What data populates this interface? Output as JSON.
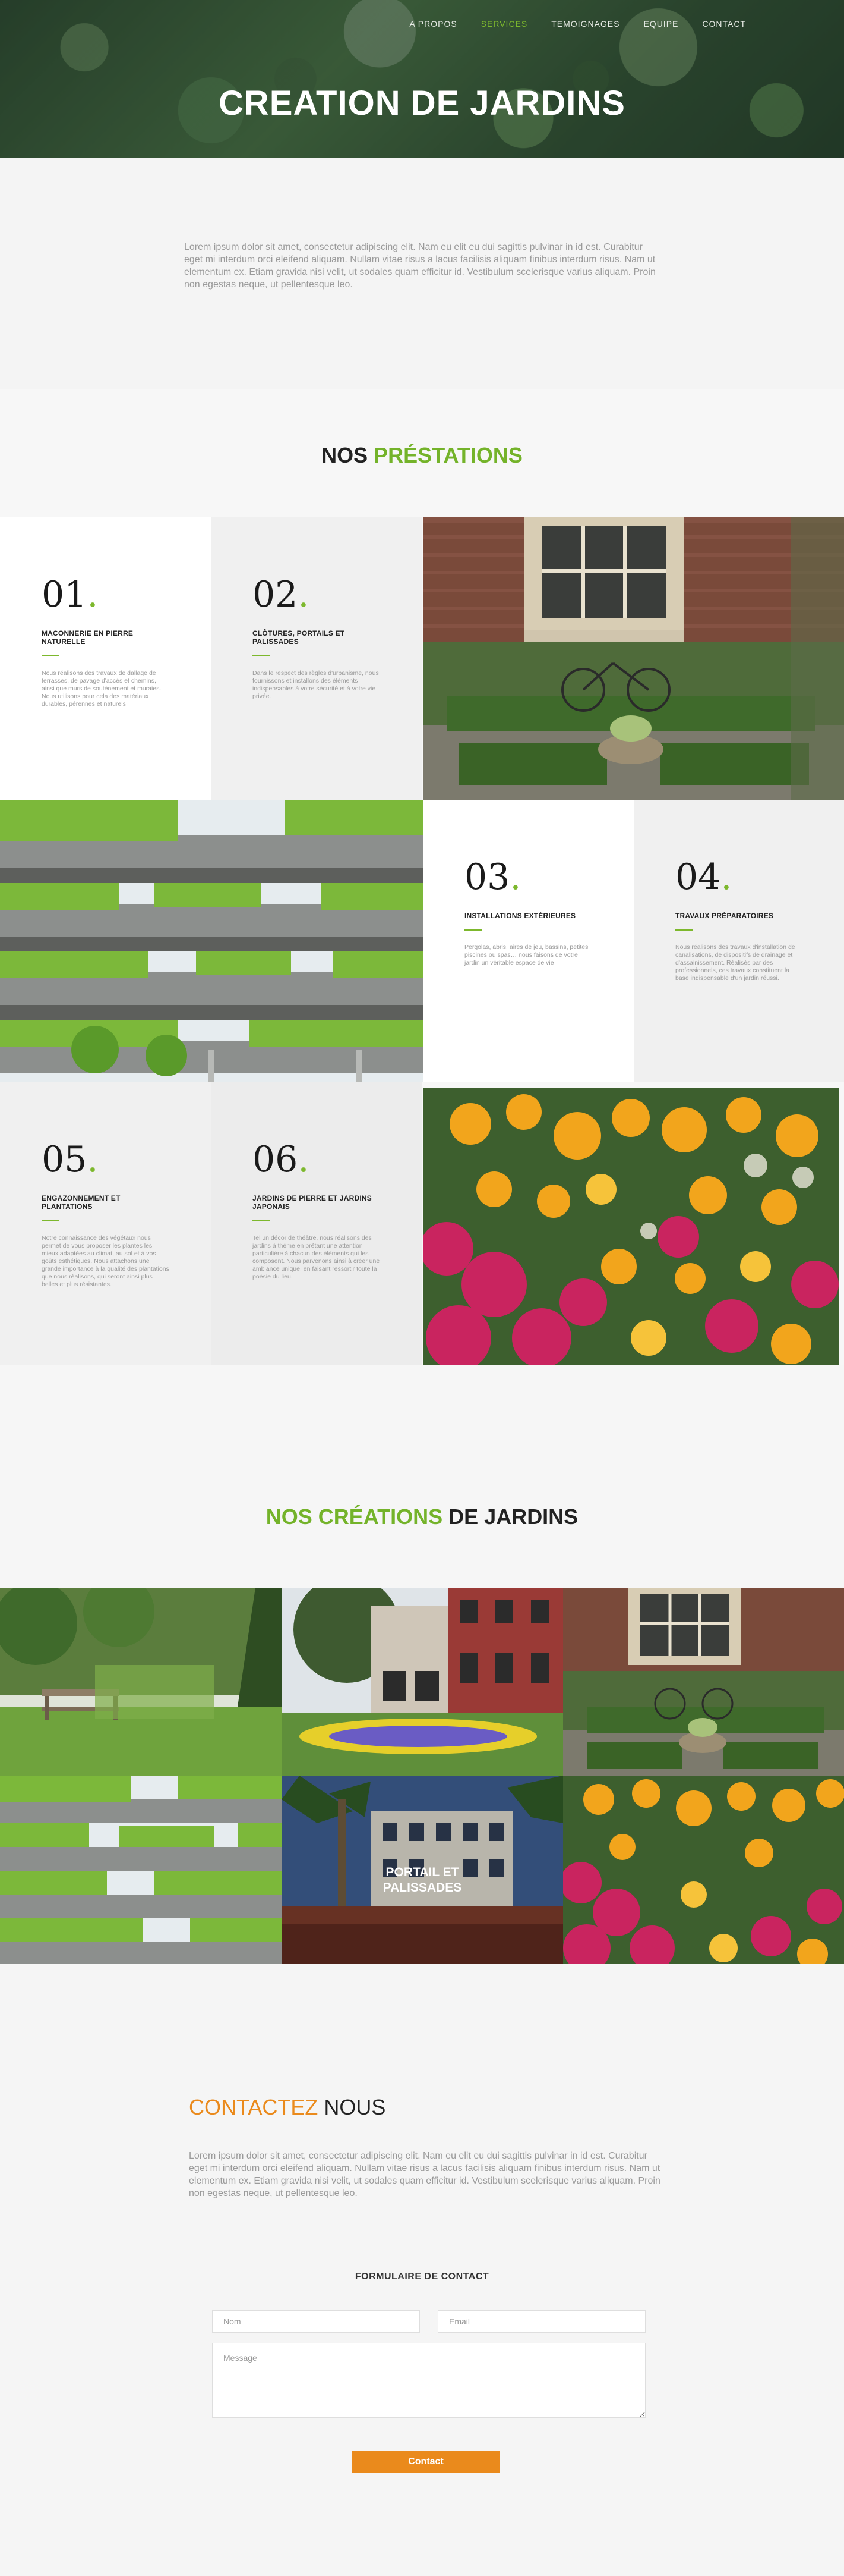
{
  "nav": {
    "items": [
      {
        "label": "A PROPOS"
      },
      {
        "label": "SERVICES"
      },
      {
        "label": "TEMOIGNAGES"
      },
      {
        "label": "EQUIPE"
      },
      {
        "label": "CONTACT"
      }
    ]
  },
  "hero": {
    "title": "CREATION DE JARDINS"
  },
  "intro": {
    "text": "Lorem ipsum dolor sit amet, consectetur adipiscing elit. Nam eu elit eu dui sagittis pulvinar in id est. Curabitur eget mi interdum orci eleifend aliquam. Nullam vitae risus a lacus facilisis aliquam finibus interdum risus. Nam ut elementum ex. Etiam gravida nisi velit, ut sodales quam efficitur id. Vestibulum scelerisque varius aliquam. Proin non egestas neque, ut pellentesque leo."
  },
  "services": {
    "title_a": "NOS ",
    "title_b": "PRÉSTATIONS",
    "items": [
      {
        "num": "01",
        "dot": ".",
        "title": "MACONNERIE EN PIERRE NATURELLE",
        "text": "Nous réalisons des travaux de dallage de terrasses, de pavage d'accès et chemins, ainsi que murs de soutènement et muraies. Nous utilisons pour cela des matériaux durables, pérennes et naturels"
      },
      {
        "num": "02",
        "dot": ".",
        "title": "CLÔTURES, PORTAILS ET PALISSADES",
        "text": "Dans le respect des règles d'urbanisme, nous fournissons et installons des éléments indispensables à votre sécurité et à votre vie privée."
      },
      {
        "num": "03",
        "dot": ".",
        "title": "INSTALLATIONS EXTÉRIEURES",
        "text": "Pergolas, abris, aires de jeu, bassins, petites piscines ou spas… nous faisons de votre jardin un véritable espace de vie"
      },
      {
        "num": "04",
        "dot": ".",
        "title": "TRAVAUX PRÉPARATOIRES",
        "text": "Nous réalisons des travaux d'installation de canalisations, de dispositifs de drainage et d'assainissement. Réalisés par des professionnels, ces travaux constituent la base indispensable d'un jardin réussi."
      },
      {
        "num": "05",
        "dot": ".",
        "title": "ENGAZONNEMENT ET PLANTATIONS",
        "text": "Notre connaissance des végétaux nous permet de vous proposer les plantes les mieux adaptées au climat, au sol et à vos goûts esthétiques. Nous attachons une grande importance à la qualité des plantations que nous réalisons, qui seront ainsi plus belles et plus résistantes."
      },
      {
        "num": "06",
        "dot": ".",
        "title": "JARDINS DE PIERRE ET JARDINS JAPONAIS",
        "text": "Tel un décor de théâtre, nous réalisons des jardins à thème en prêtant une attention particulière à chacun des éléments qui les composent. Nous parvenons ainsi à créer une ambiance unique, en faisant ressortir toute la poésie du lieu."
      }
    ]
  },
  "creations": {
    "title_a": "NOS CRÉATIONS",
    "title_b": " DE JARDINS",
    "tiles": [
      {
        "label": ""
      },
      {
        "label": ""
      },
      {
        "label": ""
      },
      {
        "label": ""
      },
      {
        "label": "PORTAIL ET PALISSADES"
      },
      {
        "label": ""
      }
    ]
  },
  "contact": {
    "title_a": "CONTACTEZ",
    "title_b": " NOUS",
    "text": "Lorem ipsum dolor sit amet, consectetur adipiscing elit. Nam eu elit eu dui sagittis pulvinar in id est. Curabitur eget mi interdum orci eleifend aliquam. Nullam vitae risus a lacus facilisis aliquam finibus interdum risus. Nam ut elementum ex. Etiam gravida nisi velit, ut sodales quam efficitur id. Vestibulum scelerisque varius aliquam. Proin non egestas neque, ut pellentesque leo.",
    "form_title": "FORMULAIRE DE CONTACT",
    "name_placeholder": "Nom",
    "email_placeholder": "Email",
    "message_placeholder": "Message",
    "submit_label": "Contact"
  },
  "colors": {
    "accent_green": "#74b32a",
    "accent_orange": "#ea8a1c"
  }
}
